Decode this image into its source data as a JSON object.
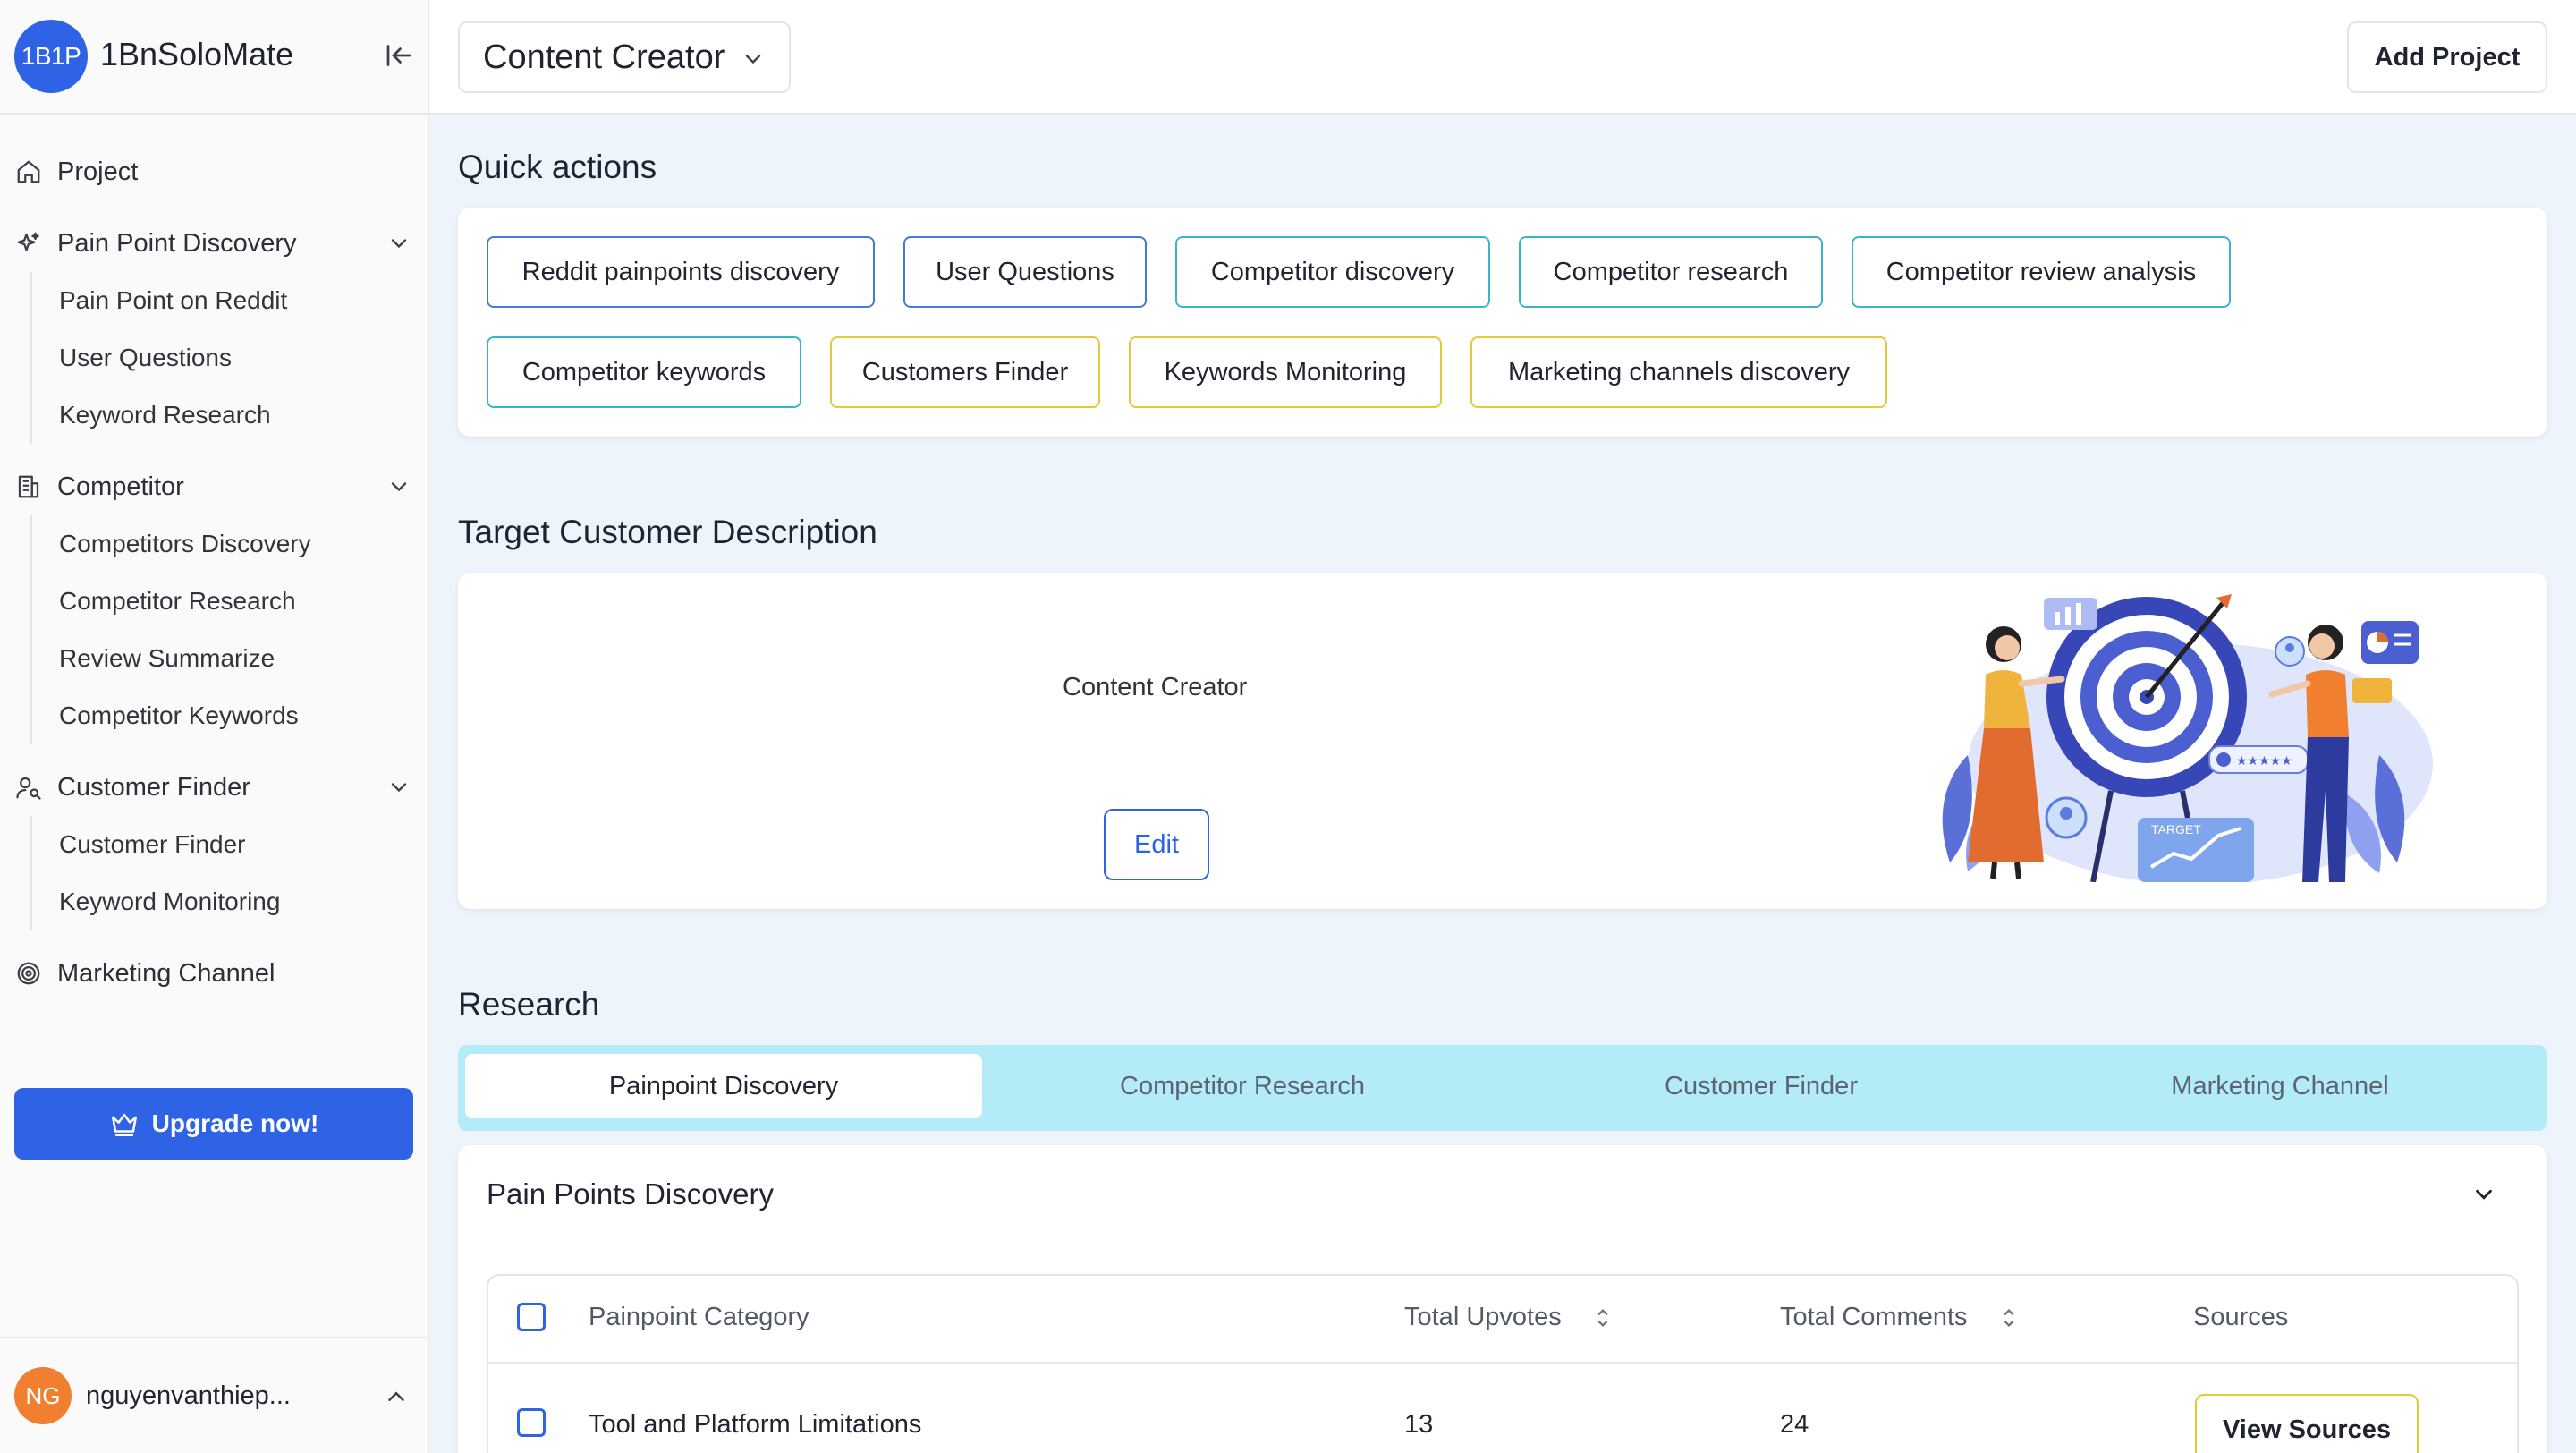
{
  "brand": {
    "logo_text": "1B1P",
    "name": "1BnSoloMate",
    "collapse_icon": "panel-collapse-icon"
  },
  "sidebar": {
    "project": {
      "label": "Project",
      "icon": "home-icon"
    },
    "groups": [
      {
        "label": "Pain Point Discovery",
        "icon": "sparkle-icon",
        "items": [
          "Pain Point on Reddit",
          "User Questions",
          "Keyword Research"
        ]
      },
      {
        "label": "Competitor",
        "icon": "building-icon",
        "items": [
          "Competitors Discovery",
          "Competitor Research",
          "Review Summarize",
          "Competitor Keywords"
        ]
      },
      {
        "label": "Customer Finder",
        "icon": "user-search-icon",
        "items": [
          "Customer Finder",
          "Keyword Monitoring"
        ]
      }
    ],
    "marketing": {
      "label": "Marketing Channel",
      "icon": "target-icon"
    },
    "upgrade_label": "Upgrade now!",
    "user": {
      "initials": "NG",
      "name": "nguyenvanthiep..."
    }
  },
  "header": {
    "project_select": "Content Creator",
    "add_project": "Add Project"
  },
  "quick_actions": {
    "title": "Quick actions",
    "items": [
      "Reddit painpoints discovery",
      "User Questions",
      "Competitor discovery",
      "Competitor research",
      "Competitor review analysis",
      "Competitor keywords",
      "Customers Finder",
      "Keywords Monitoring",
      "Marketing channels discovery"
    ]
  },
  "target_customer": {
    "title": "Target Customer Description",
    "text": "Content Creator",
    "edit_label": "Edit",
    "illustration_label": "TARGET"
  },
  "research": {
    "title": "Research",
    "tabs": [
      "Painpoint Discovery",
      "Competitor Research",
      "Customer Finder",
      "Marketing Channel"
    ],
    "active_tab": "Painpoint Discovery",
    "panel_title": "Pain Points Discovery",
    "table": {
      "headers": [
        "Painpoint Category",
        "Total Upvotes",
        "Total Comments",
        "Sources"
      ],
      "rows": [
        {
          "category": "Tool and Platform Limitations",
          "upvotes": "13",
          "comments": "24",
          "action": "View Sources"
        }
      ]
    }
  },
  "colors": {
    "primary": "#2f63e6",
    "tab_bar": "#b3ecf6",
    "avatar": "#f07f2f",
    "border_blue": "#4a78d6",
    "border_cyan": "#38b6c8",
    "border_yellow": "#e6c93a"
  }
}
